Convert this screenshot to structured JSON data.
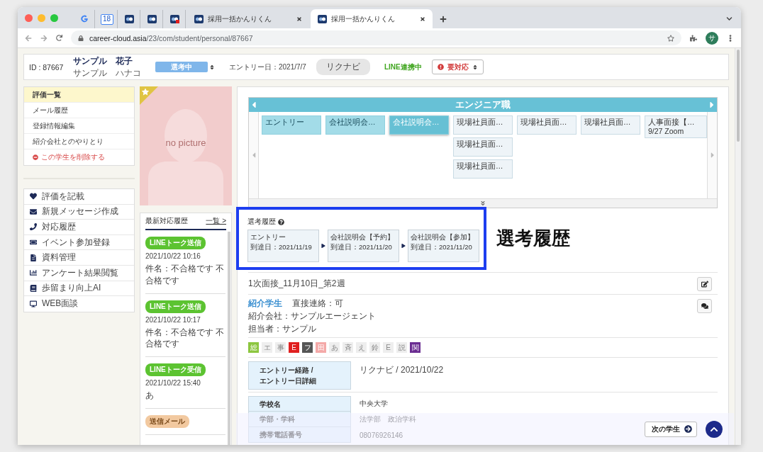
{
  "browser": {
    "tabs": [
      {
        "kind": "google",
        "selected": false
      },
      {
        "kind": "calendar",
        "badge": "18",
        "selected": false
      },
      {
        "kind": "app",
        "selected": false
      },
      {
        "kind": "app",
        "selected": false
      },
      {
        "kind": "app-alert",
        "selected": false
      },
      {
        "kind": "titled",
        "title": "採用一括かんりくん",
        "selected": false
      },
      {
        "kind": "titled",
        "title": "採用一括かんりくん",
        "selected": true
      }
    ],
    "url_host": "career-cloud.asia",
    "url_path": "/23/com/student/personal/87667",
    "profile": "サ"
  },
  "header": {
    "id": "ID : 87667",
    "name": "サンプル　花子",
    "kana": "サンプル　ハナコ",
    "status": "選考中",
    "entry_date": "エントリー日：2021/7/7",
    "source": "リクナビ",
    "line_status": "LINE連携中",
    "action": "要対応"
  },
  "menu": [
    {
      "label": "評価一覧",
      "kind": "link",
      "selected": true
    },
    {
      "label": "メール履歴",
      "kind": "link",
      "selected": false
    },
    {
      "label": "登録情報編集",
      "kind": "link",
      "selected": false
    },
    {
      "label": "紹介会社とのやりとり",
      "kind": "link",
      "selected": false
    },
    {
      "label": "この学生を削除する",
      "kind": "danger",
      "selected": false
    }
  ],
  "actions": [
    {
      "label": "評価を記載",
      "kind": "heart"
    },
    {
      "label": "新規メッセージ作成",
      "kind": "mail"
    },
    {
      "label": "対応履歴",
      "kind": "phone"
    },
    {
      "label": "イベント参加登録",
      "kind": "ticket"
    },
    {
      "label": "資料管理",
      "kind": "document"
    },
    {
      "label": "アンケート結果閲覧",
      "kind": "chart"
    },
    {
      "label": "歩留まり向上AI",
      "kind": "book"
    },
    {
      "label": "WEB面談",
      "kind": "monitor"
    }
  ],
  "photo": {
    "starred": true,
    "placeholder": "no picture"
  },
  "recent": {
    "title": "最新対応履歴",
    "link": "一覧 >",
    "entries": [
      {
        "tag": "LINEトーク送信",
        "color": "#5cc331",
        "time": "2021/10/22 10:16",
        "text": "件名：不合格です 不合格です"
      },
      {
        "tag": "LINEトーク送信",
        "color": "#5cc331",
        "time": "2021/10/22 10:17",
        "text": "件名：不合格です 不合格です"
      },
      {
        "tag": "LINEトーク受信",
        "color": "#5cc331",
        "time": "2021/10/22 15:40",
        "text": "あ"
      },
      {
        "tag": "送信メール",
        "color": "#f2c9a0"
      }
    ]
  },
  "pipeline": {
    "title": "エンジニア職",
    "columns": [
      {
        "passed": true,
        "selected": false,
        "cards": [
          {
            "label": "エントリー"
          }
        ]
      },
      {
        "passed": true,
        "selected": false,
        "cards": [
          {
            "label": "会社説明会…"
          }
        ]
      },
      {
        "passed": true,
        "selected": true,
        "cards": [
          {
            "label": "会社説明会…"
          }
        ]
      },
      {
        "passed": false,
        "selected": false,
        "cards": [
          {
            "label": "現場社員面…"
          },
          {
            "label": "現場社員面…"
          },
          {
            "label": "現場社員面…"
          }
        ]
      },
      {
        "passed": false,
        "selected": false,
        "cards": [
          {
            "label": "現場社員面…"
          }
        ]
      },
      {
        "passed": false,
        "selected": false,
        "cards": [
          {
            "label": "現場社員面…"
          }
        ]
      },
      {
        "passed": false,
        "selected": false,
        "cards": [
          {
            "label": "人事面接【…",
            "note": "9/27 Zoom"
          }
        ]
      }
    ]
  },
  "history": {
    "title": "選考履歴",
    "annotation": "選考履歴",
    "steps": [
      {
        "label": "エントリー",
        "date": "到達日：2021/11/19"
      },
      {
        "label": "会社説明会【予約】",
        "date": "到達日：2021/11/20"
      },
      {
        "label": "会社説明会【参加】",
        "date": "到達日：2021/11/20"
      }
    ]
  },
  "memo": "1次面接_11月10日_第2週",
  "referral": {
    "link": "紹介学生",
    "contact": "直接連絡：可",
    "agency": "紹介会社：サンプルエージェント",
    "person": "担当者：サンプル"
  },
  "chips": [
    {
      "label": "総",
      "color": "#8cc63f"
    },
    {
      "label": "エ",
      "color": "#eeeeee"
    },
    {
      "label": "事",
      "color": "#eeeeee"
    },
    {
      "label": "E",
      "color": "#e02020"
    },
    {
      "label": "フ",
      "color": "#555555"
    },
    {
      "label": "田",
      "color": "#f4a9a8"
    },
    {
      "label": "あ",
      "color": "#eeeeee"
    },
    {
      "label": "斉",
      "color": "#eeeeee"
    },
    {
      "label": "え",
      "color": "#eeeeee"
    },
    {
      "label": "鈴",
      "color": "#eeeeee"
    },
    {
      "label": "E",
      "color": "#eeeeee"
    },
    {
      "label": "説",
      "color": "#eeeeee"
    },
    {
      "label": "関",
      "color": "#6a2c91"
    }
  ],
  "entry_table": {
    "label_lines": [
      "エントリー経路 /",
      "エントリー日詳細"
    ],
    "value": "リクナビ / 2021/10/22"
  },
  "profile_table": [
    {
      "label": "学校名",
      "value": "中央大学"
    },
    {
      "label": "学部・学科",
      "value": "法学部　政治学科"
    },
    {
      "label": "携帯電話番号",
      "value": "08076926146"
    }
  ],
  "footer": {
    "next": "次の学生"
  }
}
